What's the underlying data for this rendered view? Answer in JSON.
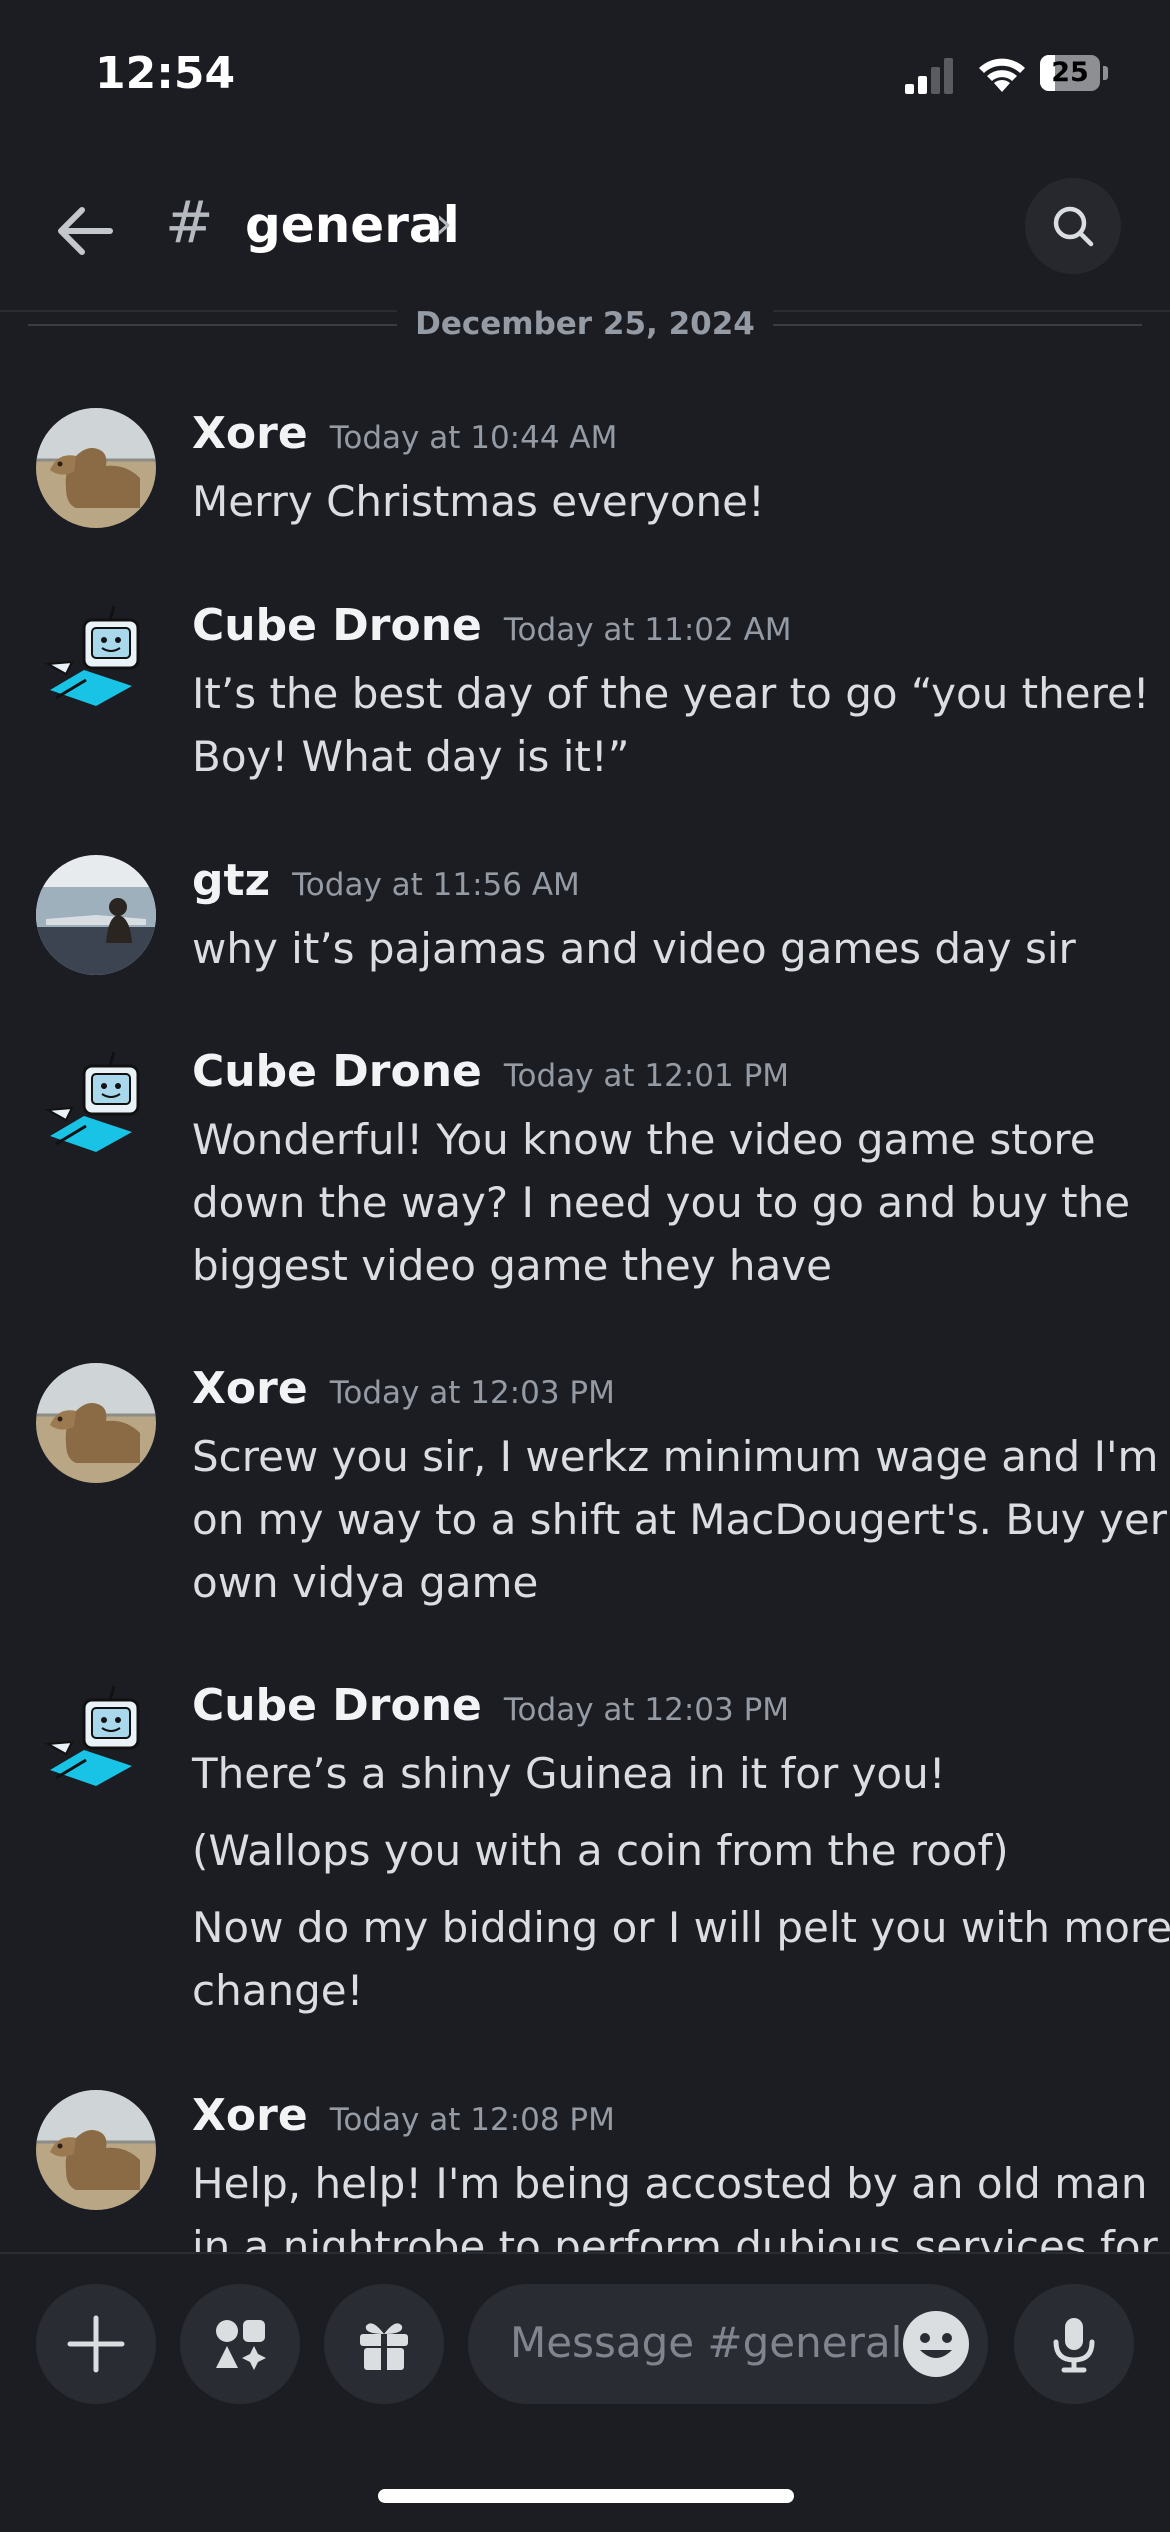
{
  "status_bar": {
    "time": "12:54",
    "battery_level": "25",
    "battery_fraction": 0.25,
    "icons": [
      "signal-icon",
      "wifi-icon",
      "battery-icon"
    ]
  },
  "header": {
    "channel_prefix": "#",
    "channel_name": "general",
    "chevron": "›",
    "back_icon": "arrow-left-icon",
    "search_icon": "search-icon"
  },
  "date_divider": "December 25, 2024",
  "messages": [
    {
      "author": "Xore",
      "timestamp": "Today at 10:44 AM",
      "avatar": "camel-avatar",
      "lines": [
        "Merry Christmas everyone!"
      ]
    },
    {
      "author": "Cube Drone",
      "timestamp": "Today at 11:02 AM",
      "avatar": "cube-drone-avatar",
      "lines": [
        "It’s the best day of the year to go “you there!",
        "Boy! What day is it!”"
      ]
    },
    {
      "author": "gtz",
      "timestamp": "Today at 11:56 AM",
      "avatar": "gtz-avatar",
      "lines": [
        "why it’s pajamas and video games day sir"
      ]
    },
    {
      "author": "Cube Drone",
      "timestamp": "Today at 12:01 PM",
      "avatar": "cube-drone-avatar",
      "lines": [
        "Wonderful! You know the video game store",
        "down the way? I need you to go and buy the",
        "biggest video game they have"
      ]
    },
    {
      "author": "Xore",
      "timestamp": "Today at 12:03 PM",
      "avatar": "camel-avatar",
      "lines": [
        "Screw you sir, I werkz minimum wage and I'm",
        "on my way to a shift at MacDougert's. Buy yer",
        "own vidya game"
      ]
    },
    {
      "author": "Cube Drone",
      "timestamp": "Today at 12:03 PM",
      "avatar": "cube-drone-avatar",
      "lines": [
        "There’s a shiny Guinea in it for you!",
        "(Wallops you with a coin from the roof)",
        "Now do my bidding or I will pelt you with more",
        "change!"
      ]
    },
    {
      "author": "Xore",
      "timestamp": "Today at 12:08 PM",
      "avatar": "camel-avatar",
      "lines": [
        "Help, help! I'm being accosted by an old man",
        "in a nightrobe to perform dubious services for"
      ]
    }
  ],
  "composer": {
    "placeholder": "Message #general",
    "buttons": [
      "plus-icon",
      "apps-icon",
      "gift-icon",
      "emoji-icon",
      "microphone-icon"
    ]
  },
  "colors": {
    "background": "#1c1d23",
    "surface": "#2a2c33",
    "text": "#dbdee1",
    "muted": "#949ba4"
  }
}
